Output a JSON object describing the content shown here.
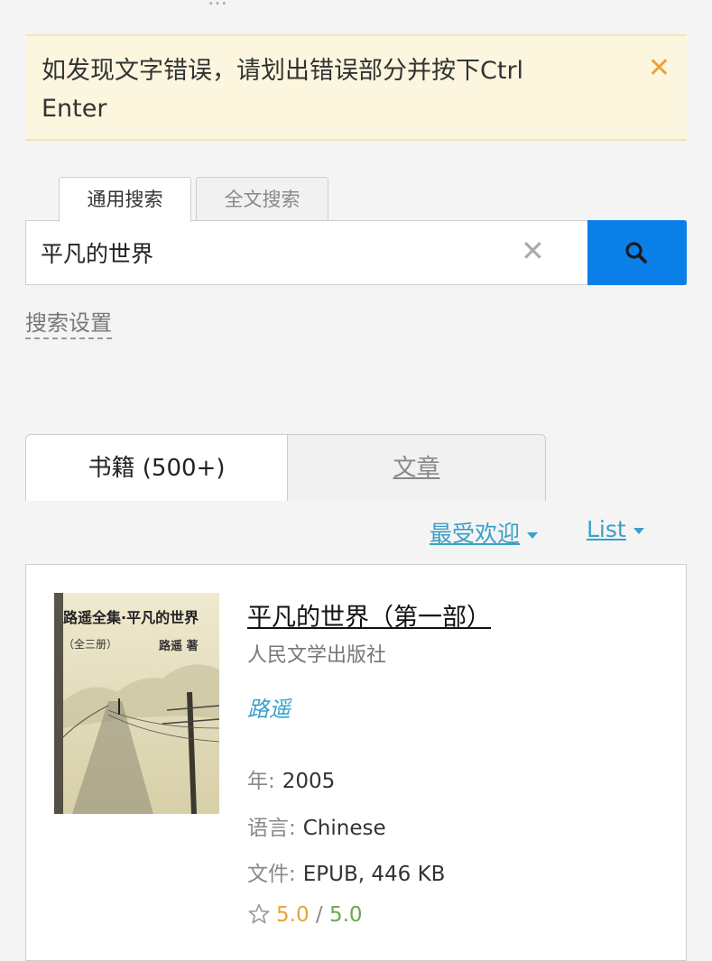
{
  "notice": {
    "text": "如发现文字错误，请划出错误部分并按下Ctrl Enter",
    "close_icon": "close-icon"
  },
  "search": {
    "tabs": [
      {
        "label": "通用搜索",
        "active": true
      },
      {
        "label": "全文搜索",
        "active": false
      }
    ],
    "value": "平凡的世界",
    "settings_label": "搜索设置"
  },
  "results": {
    "tabs": [
      {
        "label": "书籍 (500+)",
        "active": true
      },
      {
        "label": "文章",
        "active": false
      }
    ],
    "sort_label": "最受欢迎",
    "view_label": "List"
  },
  "book": {
    "cover_title": "路遥全集·平凡的世界",
    "cover_sub": "（全三册）",
    "cover_author": "路遥 著",
    "title": "平凡的世界（第一部）",
    "publisher": "人民文学出版社",
    "author": "路遥",
    "year_label": "年:",
    "year": "2005",
    "lang_label": "语言:",
    "lang": "Chinese",
    "file_label": "文件:",
    "file": "EPUB, 446 KB",
    "rating_user": "5.0",
    "rating_sep": "/",
    "rating_quality": "5.0"
  },
  "colors": {
    "accent": "#0a7fe8",
    "link": "#3aa0c8",
    "notice_bg": "#fcf6df"
  }
}
